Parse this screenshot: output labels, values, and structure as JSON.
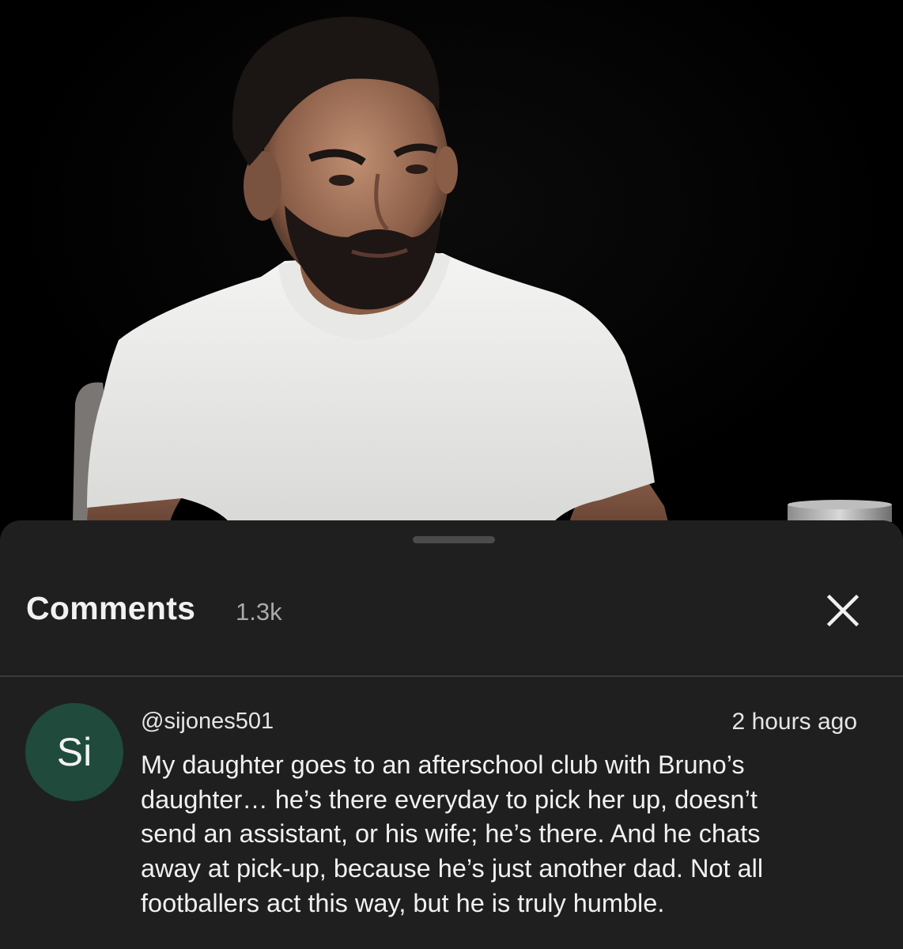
{
  "video": {
    "description_icon": "video-frame"
  },
  "comments_panel": {
    "title": "Comments",
    "count": "1.3k",
    "close_icon": "close-icon"
  },
  "comments": [
    {
      "avatar_initials": "Si",
      "avatar_color": "#1f4a3c",
      "author": "@sijones501",
      "time": "2 hours ago",
      "text_lines": [
        "My daughter goes to an afterschool club with Bruno’s",
        "daughter… he’s there everyday to pick her up, doesn’t",
        "send an assistant, or his wife; he’s there. And he chats",
        "away at pick-up, because he’s just another dad. Not all",
        "footballers act this way, but he is truly humble."
      ]
    }
  ],
  "colors": {
    "sheet_background": "#1f1f1f",
    "video_background": "#000000",
    "primary_text": "#f1f1f1",
    "secondary_text": "#aaaaaa"
  }
}
